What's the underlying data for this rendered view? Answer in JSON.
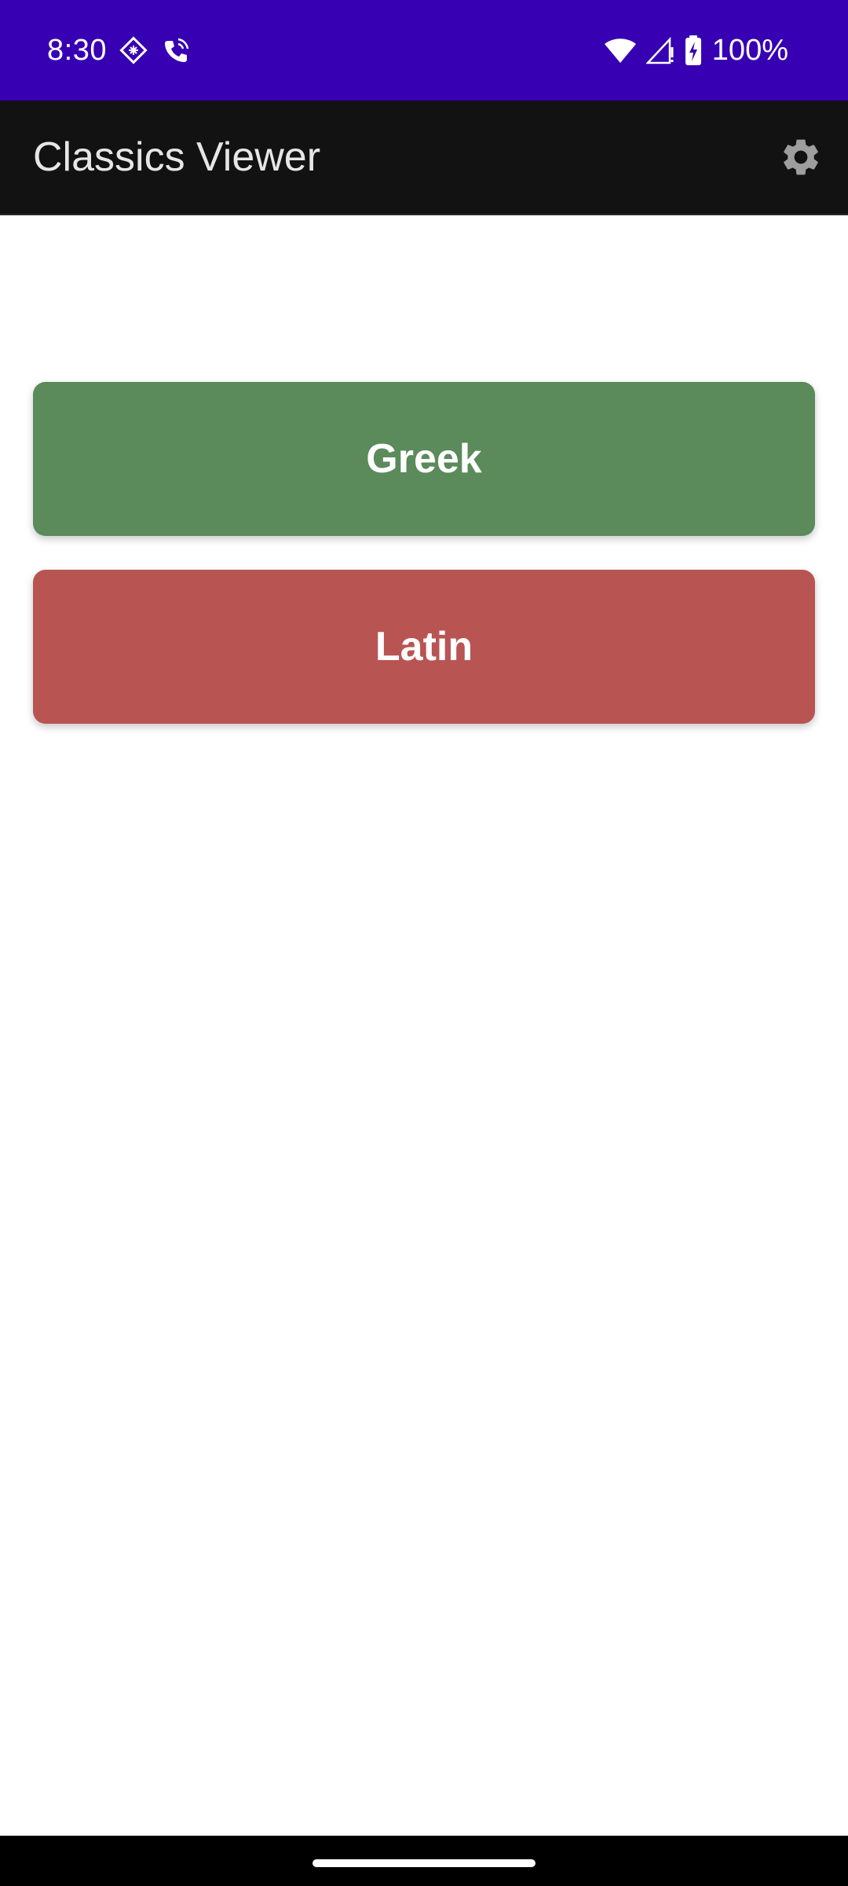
{
  "status_bar": {
    "time": "8:30",
    "battery_text": "100%",
    "icons": [
      "dev-badge-icon",
      "wifi-calling-icon",
      "wifi-icon",
      "signal-icon",
      "battery-charging-icon"
    ]
  },
  "app_bar": {
    "title": "Classics Viewer",
    "settings_icon": "gear-icon"
  },
  "main": {
    "buttons": [
      {
        "label": "Greek",
        "color": "#5b8a5b"
      },
      {
        "label": "Latin",
        "color": "#b85553"
      }
    ]
  },
  "colors": {
    "status_bar": "#3700b3",
    "app_bar": "#121212",
    "background": "#ffffff"
  }
}
